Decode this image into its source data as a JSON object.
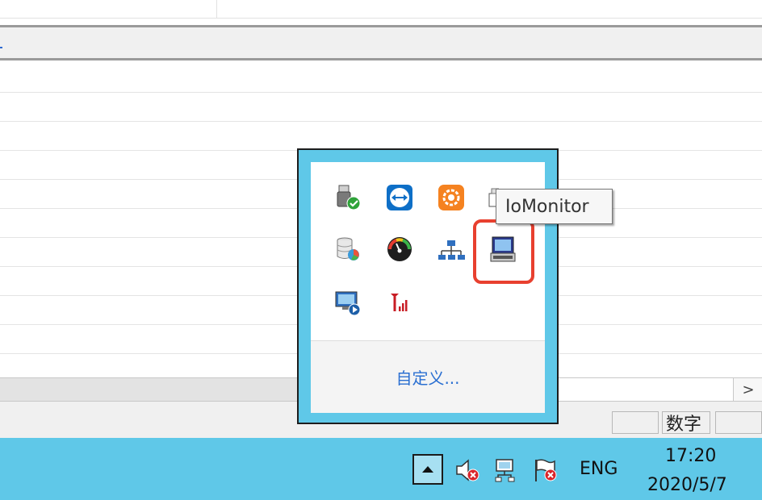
{
  "status_bar": {
    "cells": [
      "",
      "数字",
      ""
    ]
  },
  "hscroll": {
    "right_arrow": ">"
  },
  "notification_overflow": {
    "icons": [
      {
        "name": "usb-safely-remove-icon"
      },
      {
        "name": "teamviewer-icon"
      },
      {
        "name": "orange-gear-app-icon"
      },
      {
        "name": "partial-hidden-icon"
      },
      {
        "name": "database-chart-icon"
      },
      {
        "name": "gauge-speedometer-icon"
      },
      {
        "name": "network-topology-icon"
      },
      {
        "name": "iomonitor-icon"
      },
      {
        "name": "remote-desktop-play-icon"
      },
      {
        "name": "signal-antenna-icon"
      }
    ],
    "tooltip": "IoMonitor",
    "customize_link": "自定义..."
  },
  "taskbar": {
    "language": "ENG",
    "time": "17:20",
    "date": "2020/5/7"
  },
  "colors": {
    "taskbar": "#5fc8e8",
    "highlight": "#e8402f",
    "link": "#2a6fd1"
  }
}
